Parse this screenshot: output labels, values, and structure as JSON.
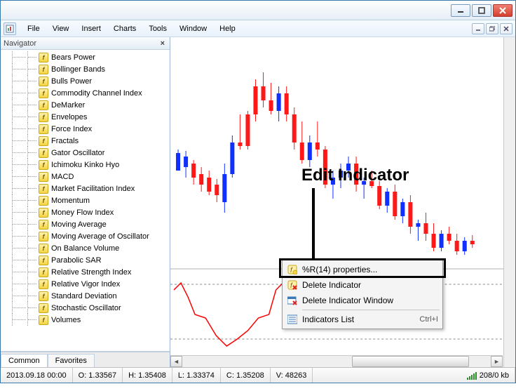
{
  "menu": {
    "file": "File",
    "view": "View",
    "insert": "Insert",
    "charts": "Charts",
    "tools": "Tools",
    "window": "Window",
    "help": "Help"
  },
  "navigator": {
    "title": "Navigator",
    "tabs": {
      "common": "Common",
      "favorites": "Favorites"
    },
    "indicators": [
      "Bears Power",
      "Bollinger Bands",
      "Bulls Power",
      "Commodity Channel Index",
      "DeMarker",
      "Envelopes",
      "Force Index",
      "Fractals",
      "Gator Oscillator",
      "Ichimoku Kinko Hyo",
      "MACD",
      "Market Facilitation Index",
      "Momentum",
      "Money Flow Index",
      "Moving Average",
      "Moving Average of Oscillator",
      "On Balance Volume",
      "Parabolic SAR",
      "Relative Strength Index",
      "Relative Vigor Index",
      "Standard Deviation",
      "Stochastic Oscillator",
      "Volumes"
    ]
  },
  "context_menu": {
    "properties": "%R(14) properties...",
    "delete_ind": "Delete Indicator",
    "delete_win": "Delete Indicator Window",
    "list": "Indicators List",
    "list_shortcut": "Ctrl+I"
  },
  "annotation": "Edit Indicator",
  "status": {
    "datetime": "2013.09.18 00:00",
    "open": "O: 1.33567",
    "high": "H: 1.35408",
    "low": "L: 1.33374",
    "close": "C: 1.35208",
    "vol": "V: 48263",
    "conn": "208/0 kb"
  },
  "chart_data": {
    "type": "candlestick+indicator",
    "main_panel": {
      "note": "EURUSD candlestick price chart (approx)",
      "y_range": [
        1.3,
        1.37
      ]
    },
    "indicator_panel": {
      "name": "Williams %R(14)",
      "color": "#ff0000",
      "y_range": [
        -100,
        0
      ],
      "levels": [
        -20,
        -80
      ]
    }
  }
}
